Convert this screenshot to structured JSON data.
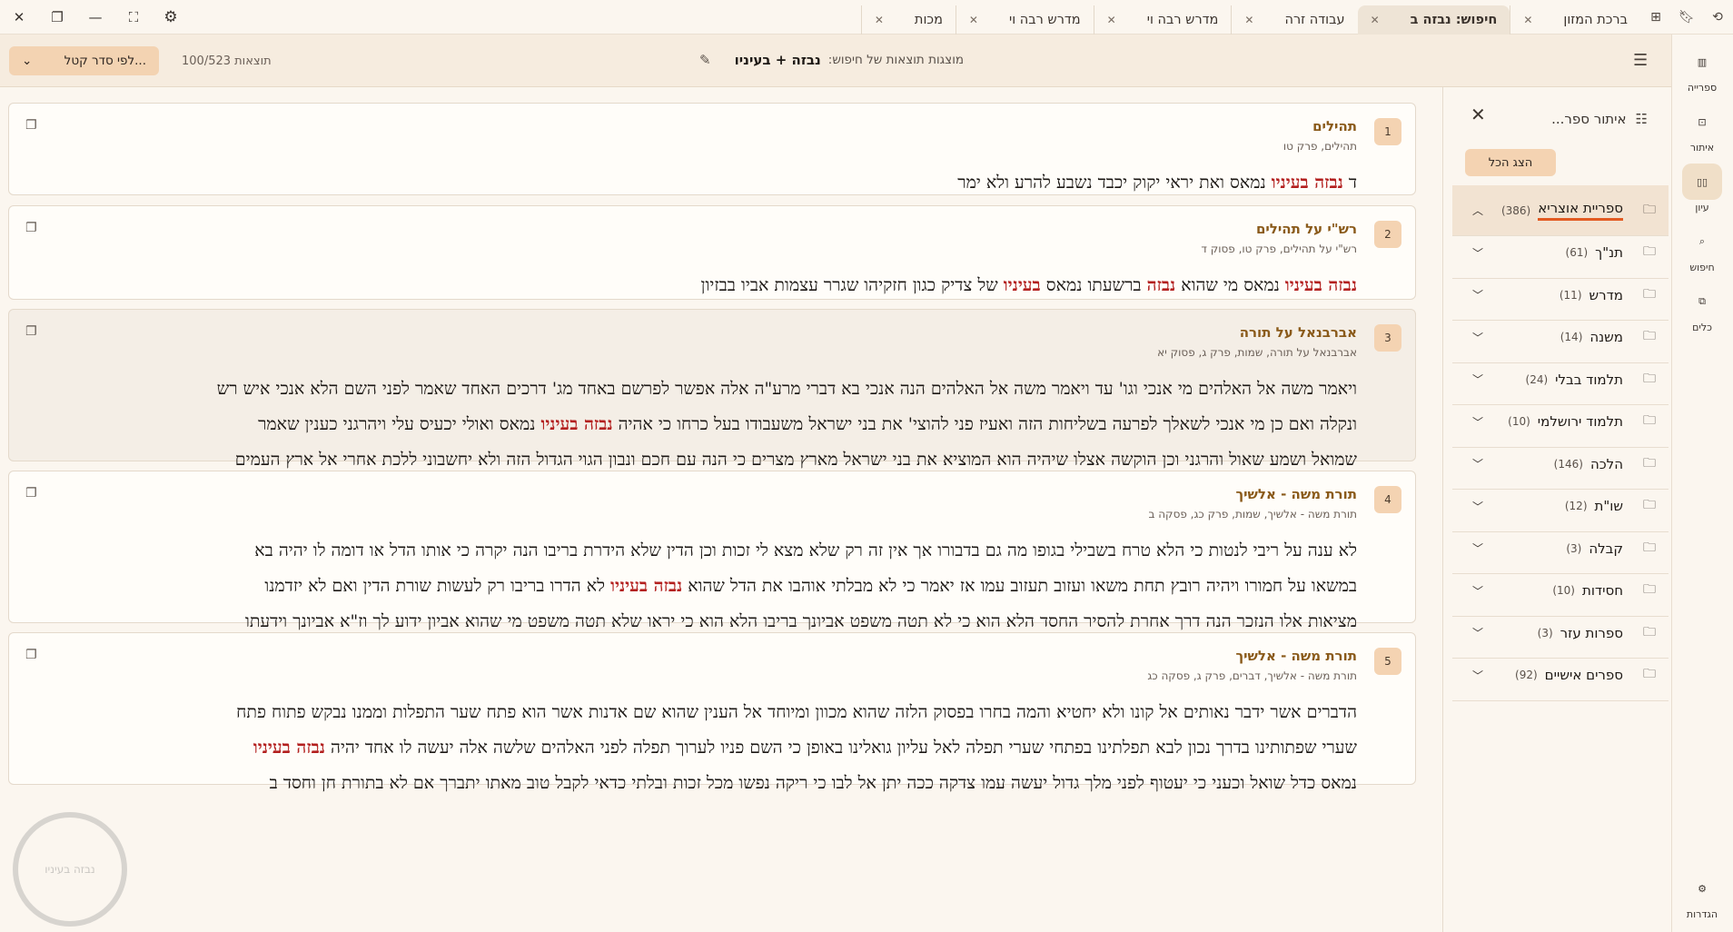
{
  "window_controls": {
    "close": "close-icon",
    "restore": "restore-icon",
    "minimize": "minimize-icon",
    "fullscreen": "fullscreen-icon",
    "settings": "gear-icon"
  },
  "tabs": [
    {
      "label": "ברכת המזון",
      "active": false
    },
    {
      "label": "חיפוש: נבזה ב",
      "active": true
    },
    {
      "label": "עבודה זרה",
      "active": false
    },
    {
      "label": "מדרש רבה וי",
      "active": false
    },
    {
      "label": "מדרש רבה וי",
      "active": false
    },
    {
      "label": "מכות",
      "active": false
    }
  ],
  "header": {
    "sort_label": "לפי סדר קטל...",
    "results_count": "100/523 תוצאות",
    "search_prefix": "מוצגות תוצאות של חיפוש:",
    "search_query": "נבזה + בעיניו"
  },
  "results": [
    {
      "num": "1",
      "title": "תהילים",
      "ref": "תהילים, פרק טו",
      "lines": [
        [
          [
            "ד ",
            false
          ],
          [
            "נבזה בעיניו",
            true
          ],
          [
            " נמאס ואת יראי יקוק יכבד נשבע להרע ולא ימר",
            false
          ]
        ]
      ]
    },
    {
      "num": "2",
      "title": "רש\"י על תהילים",
      "ref": "רש\"י על תהילים, פרק טו, פסוק ד",
      "lines": [
        [
          [
            "נבזה בעיניו",
            true
          ],
          [
            " נמאס מי שהוא ",
            false
          ],
          [
            "נבזה",
            true
          ],
          [
            " ברשעתו נמאס ",
            false
          ],
          [
            "בעיניו",
            true
          ],
          [
            " של צדיק כגון חזקיהו שגרר עצמות אביו בבזיון",
            false
          ]
        ]
      ]
    },
    {
      "num": "3",
      "title": "אברבנאל על תורה",
      "ref": "אברבנאל על תורה, שמות, פרק ג, פסוק יא",
      "lines": [
        [
          [
            "ויאמר משה אל האלהים מי אנכי וגו' עד ויאמר משה אל האלהים הנה אנכי בא דברי מרע\"ה אלה אפשר לפרשם באחד מג' דרכים האחד שאמר לפני השם הלא אנכי איש רש",
            false
          ]
        ],
        [
          [
            "ונקלה ואם כן מי אנכי לשאלך לפרעה בשליחות הזה ואעיז פני להוצי' את בני ישראל משעבודו בעל כרחו כי אהיה ",
            false
          ],
          [
            "נבזה בעיניו",
            true
          ],
          [
            " נמאס ואולי יכעיס עלי ויהרגני כענין שאמר",
            false
          ]
        ],
        [
          [
            "שמואל ושמע שאול והרגני וכן הוקשה אצלו שיהיה הוא המוציא את בני ישראל מארץ מצרים כי הנה עם חכם ונבון הגוי הגדול הזה ולא יחשבוני ללכת אחרי אל ארץ העמים",
            false
          ]
        ]
      ]
    },
    {
      "num": "4",
      "title": "תורת משה - אלשיך",
      "ref": "תורת משה - אלשיך, שמות, פרק כג, פסקה ב",
      "lines": [
        [
          [
            "לא ענה על ריבי לנטות כי הלא טרח בשבילי בגופו מה גם בדבורו אך אין זה רק שלא מצא לי זכות וכן הדין שלא הידרת בריבו הנה יקרה כי אותו הדל או דומה לו יהיה בא",
            false
          ]
        ],
        [
          [
            "במשאו על חמורו ויהיה רובץ תחת משאו ועזוב תעזוב עמו אז יאמר כי לא מבלתי אוהבו את הדל שהוא ",
            false
          ],
          [
            "נבזה בעיניו",
            true
          ],
          [
            " לא הדרו בריבו רק לעשות שורת הדין ואם לא יזדמנו",
            false
          ]
        ],
        [
          [
            "מציאות אלו הנזכר הנה דרך אחרת להסיר החסד הלא הוא כי לא תטה משפט אביונך בריבו הלא הוא כי יראו שלא תטה משפט מי שהוא אביון ידוע לך וז\"א אביונך וידעתו",
            false
          ]
        ]
      ]
    },
    {
      "num": "5",
      "title": "תורת משה - אלשיך",
      "ref": "תורת משה - אלשיך, דברים, פרק ג, פסקה כג",
      "lines": [
        [
          [
            "הדברים אשר ידבר נאותים אל קונו ולא יחטיא והמה בחרו בפסוק הלזה שהוא מכוון ומיוחד אל הענין שהוא שם אדנות אשר הוא פתח שער התפלות וממנו נבקש פתוח פתח",
            false
          ]
        ],
        [
          [
            "שערי שפתותינו בדרך נכון לבא תפלתינו בפתחי שערי תפלה לאל עליון גואלינו באופן כי השם פניו לערוך תפלה לפני האלהים שלשה אלה יעשה לו אחד יהיה ",
            false
          ],
          [
            "נבזה בעיניו",
            true
          ]
        ],
        [
          [
            "נמאס כדל שואל וכעני כי יעטוף לפני מלך גדול יעשה עמו צדקה ככה יתן אל לבו כי ריקה נפשו מכל זכות ובלתי כדאי לקבל טוב מאתו יתברך אם לא בתורת חן וחסד ב",
            false
          ]
        ]
      ]
    }
  ],
  "panel": {
    "filter_placeholder": "איתור ספר...",
    "show_all": "הצג הכל",
    "categories": [
      {
        "name": "ספריית אוצריא",
        "count": "(386)",
        "expanded": true
      },
      {
        "name": "תנ\"ך",
        "count": "(61)",
        "expanded": false
      },
      {
        "name": "מדרש",
        "count": "(11)",
        "expanded": false
      },
      {
        "name": "משנה",
        "count": "(14)",
        "expanded": false
      },
      {
        "name": "תלמוד בבלי",
        "count": "(24)",
        "expanded": false
      },
      {
        "name": "תלמוד ירושלמי",
        "count": "(10)",
        "expanded": false
      },
      {
        "name": "הלכה",
        "count": "(146)",
        "expanded": false
      },
      {
        "name": "שו\"ת",
        "count": "(12)",
        "expanded": false
      },
      {
        "name": "קבלה",
        "count": "(3)",
        "expanded": false
      },
      {
        "name": "חסידות",
        "count": "(10)",
        "expanded": false
      },
      {
        "name": "ספרות עזר",
        "count": "(3)",
        "expanded": false
      },
      {
        "name": "ספרים אישיים",
        "count": "(92)",
        "expanded": false
      }
    ]
  },
  "rail": [
    {
      "label": "ספרייה",
      "icon": "library-icon",
      "active": false
    },
    {
      "label": "איתור",
      "icon": "locate-book-icon",
      "active": false
    },
    {
      "label": "עיון",
      "icon": "open-book-icon",
      "active": true
    },
    {
      "label": "חיפוש",
      "icon": "search-icon",
      "active": false
    },
    {
      "label": "כלים",
      "icon": "tools-icon",
      "active": false
    },
    {
      "label": "הגדרות",
      "icon": "gear-icon",
      "active": false
    }
  ],
  "watermark_text": "נבזה בעיניו"
}
